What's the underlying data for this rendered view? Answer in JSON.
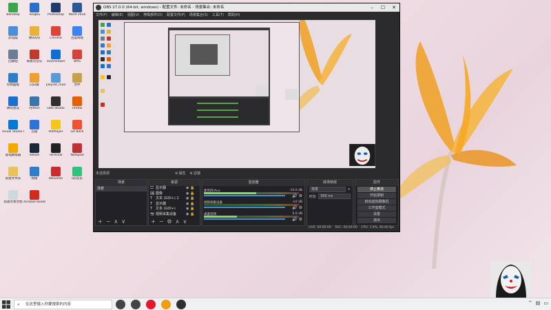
{
  "desktop": {
    "icons": [
      {
        "label": "Bandizip",
        "color": "#3aa64a"
      },
      {
        "label": "Tongbu",
        "color": "#2c6ecb"
      },
      {
        "label": "PhotoShop",
        "color": "#1f3a6b"
      },
      {
        "label": "Word 2016",
        "color": "#2b5797"
      },
      {
        "label": "此电脑",
        "color": "#4a90d9"
      },
      {
        "label": "腾讯QQ",
        "color": "#e8b23a"
      },
      {
        "label": "Chrome",
        "color": "#db4437"
      },
      {
        "label": "百度网盘",
        "color": "#3b82f6"
      },
      {
        "label": "回收站",
        "color": "#6b7c93"
      },
      {
        "label": "网易云音乐",
        "color": "#c0392b"
      },
      {
        "label": "TeamViewer",
        "color": "#0e6dd3"
      },
      {
        "label": "WPS",
        "color": "#d6413b"
      },
      {
        "label": "控制面板",
        "color": "#2e7dc9"
      },
      {
        "label": "向日葵",
        "color": "#f0a030"
      },
      {
        "label": "playlist_mod",
        "color": "#5a9bd5"
      },
      {
        "label": "文件",
        "color": "#c8a24a"
      },
      {
        "label": "腾讯会议",
        "color": "#1a6fd1"
      },
      {
        "label": "Python",
        "color": "#3776ab"
      },
      {
        "label": "OBS Studio",
        "color": "#302e31"
      },
      {
        "label": "Firefox",
        "color": "#e66000"
      },
      {
        "label": "Visual Studio Code",
        "color": "#0078d4"
      },
      {
        "label": "迅雷",
        "color": "#2f73d9"
      },
      {
        "label": "PotPlayer",
        "color": "#f5c518"
      },
      {
        "label": "Git Bash",
        "color": "#f05133"
      },
      {
        "label": "雷电模拟器",
        "color": "#f2a900"
      },
      {
        "label": "Steam",
        "color": "#1b2838"
      },
      {
        "label": "Terminal",
        "color": "#222"
      },
      {
        "label": "Notepad",
        "color": "#b33"
      },
      {
        "label": "新建文件夹",
        "color": "#e8c25a"
      },
      {
        "label": "网络",
        "color": "#2e7dc9"
      },
      {
        "label": "WeGame",
        "color": "#c82c2c"
      },
      {
        "label": "QQ音乐",
        "color": "#31c27c"
      },
      {
        "label": "新建文本文档",
        "color": "#cfd8dc"
      },
      {
        "label": "Acrobat Reader",
        "color": "#d12a1e"
      }
    ]
  },
  "obs": {
    "title": "OBS 27.0.0 (64-bit, windows) - 配置文件: 未命名 - 场景集合: 未命名",
    "menu": [
      "文件(F)",
      "编辑(E)",
      "视图(V)",
      "停靠部件(D)",
      "配置文件(P)",
      "场景集合(S)",
      "工具(T)",
      "帮助(H)"
    ],
    "no_source_selected": "未选择源",
    "properties_btn": "属性",
    "filters_btn": "滤镜",
    "docks": {
      "scenes": {
        "title": "场景",
        "items": [
          "场景"
        ]
      },
      "sources": {
        "title": "来源",
        "items": [
          {
            "icon": "🖵",
            "label": "显示器"
          },
          {
            "icon": "🖼",
            "label": "图像"
          },
          {
            "icon": "T",
            "label": "文本 (GDI+) 2"
          },
          {
            "icon": "T",
            "label": "显示器"
          },
          {
            "icon": "T",
            "label": "文本 (GDI+)"
          },
          {
            "icon": "📷",
            "label": "视频采集设备"
          }
        ]
      },
      "mixer": {
        "title": "混音器",
        "channels": [
          {
            "name": "麦克风/Aux",
            "db": "-10.0 dB",
            "level": 0.55
          },
          {
            "name": "视频采集设备",
            "db": "-inf dB",
            "level": 0.0
          },
          {
            "name": "桌面音频",
            "db": "0.0 dB",
            "level": 0.35
          }
        ]
      },
      "transitions": {
        "title": "转场特效",
        "type": "渐变",
        "duration_label": "时长",
        "duration": "300 ms"
      },
      "controls": {
        "title": "控件",
        "buttons": [
          "停止推流",
          "开始录制",
          "启动虚拟摄像机",
          "工作室模式",
          "设置",
          "退出"
        ]
      }
    },
    "status": {
      "live": "LIVE: 00:00:00",
      "rec": "REC: 00:00:00",
      "cpu": "CPU: 3.9%, 60.00 fps"
    }
  },
  "taskbar": {
    "search_placeholder": "在这里输入你要搜索的内容",
    "apps": [
      {
        "name": "cortana",
        "color": "#444"
      },
      {
        "name": "task-view",
        "color": "#444"
      },
      {
        "name": "weibo",
        "color": "#e6162d"
      },
      {
        "name": "browser",
        "color": "#f39c12"
      },
      {
        "name": "obs",
        "color": "#302e31"
      }
    ]
  }
}
